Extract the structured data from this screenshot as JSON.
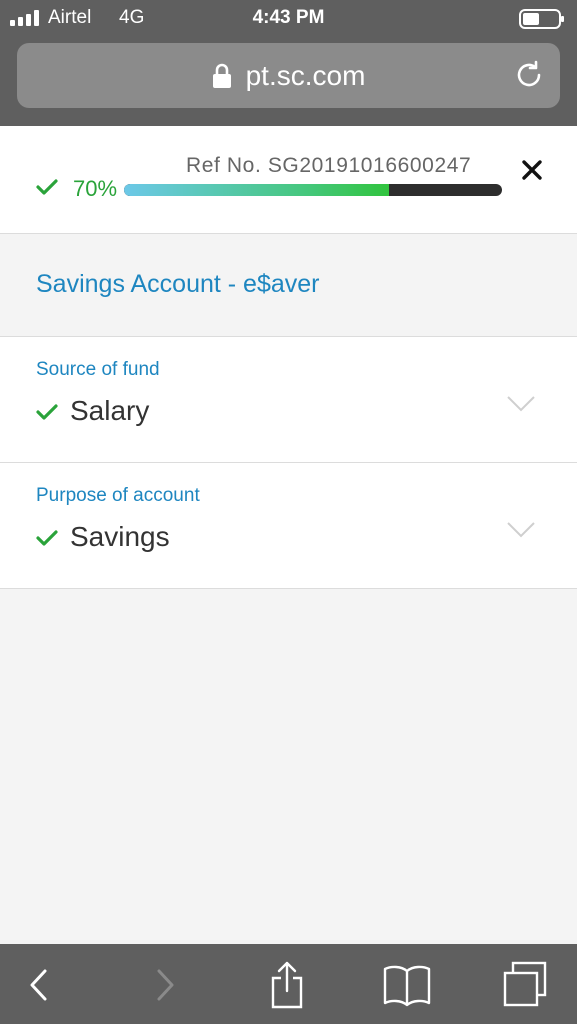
{
  "status_bar": {
    "carrier": "Airtel",
    "network": "4G",
    "time": "4:43 PM"
  },
  "browser": {
    "url": "pt.sc.com"
  },
  "application": {
    "ref_no": "Ref No. SG20191016600247",
    "progress_label": "70%",
    "progress": 0.7,
    "account_title": "Savings Account - e$aver"
  },
  "fields": [
    {
      "label": "Source of fund",
      "value": "Salary"
    },
    {
      "label": "Purpose of account",
      "value": "Savings"
    }
  ],
  "colors": {
    "accent_blue": "#1e86c0",
    "check_green": "#2aa33a",
    "chrome_gray": "#5f5f5f"
  },
  "icons": [
    "signal-icon",
    "battery-icon",
    "lock-icon",
    "reload-icon",
    "close-icon",
    "check-icon",
    "chevron-down-icon",
    "back-icon",
    "forward-icon",
    "share-icon",
    "bookmarks-icon",
    "tabs-icon"
  ]
}
